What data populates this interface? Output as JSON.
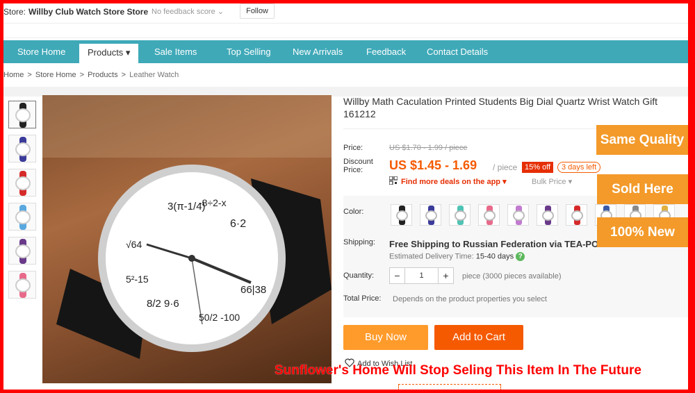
{
  "store": {
    "label": "Store:",
    "name": "Willby Club Watch Store Store",
    "feedback": "No feedback score ⌄",
    "follow_label": "Follow"
  },
  "nav": {
    "items": [
      {
        "label": "Store Home"
      },
      {
        "label": "Products ▾"
      },
      {
        "label": "Sale Items"
      },
      {
        "label": "Top Selling"
      },
      {
        "label": "New Arrivals"
      },
      {
        "label": "Feedback"
      },
      {
        "label": "Contact Details"
      }
    ],
    "active_index": 1
  },
  "breadcrumb": [
    "Home",
    ">",
    "Store Home",
    ">",
    "Products",
    ">",
    "Leather Watch"
  ],
  "product": {
    "title": "Willby Math Caculation Printed Students Big Dial Quartz Wrist Watch Gift 161212",
    "price_label": "Price:",
    "original_price": "US $1.70 - 1.99 / piece",
    "discount_label": "Discount Price:",
    "discount_price": "US $1.45 - 1.69",
    "unit": "/ piece",
    "discount_badge": "15% off",
    "days_left": "3 days left",
    "app_deals": "Find more deals on the app ▾",
    "tiered": "Bulk Price ▾",
    "color_label": "Color:",
    "shipping_label": "Shipping:",
    "shipping_text": "Free Shipping to Russian Federation via TEA-POST",
    "delivery_label": "Estimated Delivery Time:",
    "delivery_value": "15-40 days",
    "quantity_label": "Quantity:",
    "quantity_value": "1",
    "quantity_note": "piece (3000 pieces available)",
    "total_label": "Total Price:",
    "total_note": "Depends on the product properties you select",
    "buy_now": "Buy Now",
    "add_to_cart": "Add to Cart",
    "wish_list": "Add to Wish List"
  },
  "colors": [
    "#222222",
    "#3b3b9a",
    "#4fc3b5",
    "#e86a8a",
    "#c27bd0",
    "#6a3a8a",
    "#d62a2a",
    "#3a5aa8",
    "#8a8a8a",
    "#e0b040"
  ],
  "thumb_colors": [
    "#222222",
    "#3b3b9a",
    "#d62a2a",
    "#5aa8e0",
    "#6a3a8a",
    "#e86a8a"
  ],
  "badges": [
    "Same Quality",
    "Sold Here",
    "100% New"
  ],
  "promo_text": "Sunflower's Home Will Stop Seling This Item In The Future",
  "icons": {
    "qr": "qr-code-icon",
    "heart": "heart-icon",
    "help": "question-icon"
  }
}
